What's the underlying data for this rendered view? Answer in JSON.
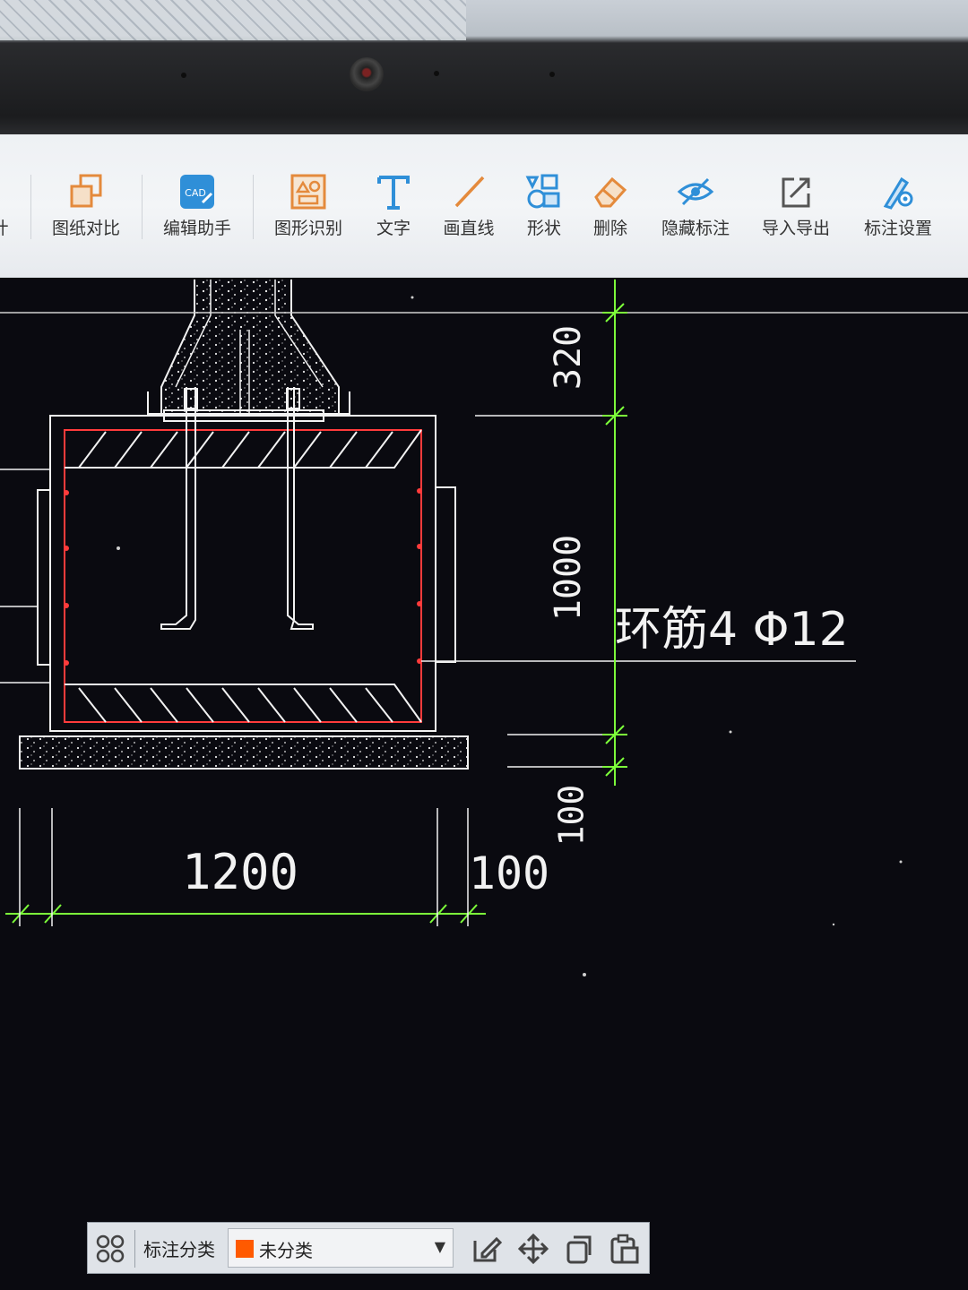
{
  "toolbar": {
    "partial_label": "计",
    "items": [
      {
        "label": "图纸对比",
        "icon": "compare-drawings-icon"
      },
      {
        "label": "编辑助手",
        "icon": "cad-edit-assistant-icon",
        "badge": "CAD"
      },
      {
        "label": "图形识别",
        "icon": "shape-recognition-icon"
      },
      {
        "label": "文字",
        "icon": "text-tool-icon"
      },
      {
        "label": "画直线",
        "icon": "draw-line-icon"
      },
      {
        "label": "形状",
        "icon": "shapes-icon"
      },
      {
        "label": "删除",
        "icon": "eraser-icon"
      },
      {
        "label": "隐藏标注",
        "icon": "hide-annotation-icon"
      },
      {
        "label": "导入导出",
        "icon": "import-export-icon"
      },
      {
        "label": "标注设置",
        "icon": "annotation-settings-icon"
      }
    ]
  },
  "drawing": {
    "dim_top": "320",
    "dim_middle": "1000",
    "dim_bottom_vertical": "100",
    "dim_width": "1200",
    "dim_side": "100",
    "annotation": "环筋4 Φ12"
  },
  "bottom_bar": {
    "label": "标注分类",
    "selected_value": "未分类",
    "swatch_color": "#ff5a00"
  },
  "colors": {
    "dimension_green": "#7dff3a",
    "outline_white": "#f2f2f2",
    "rebar_red": "#ff3b3b",
    "toolbar_blue": "#2f8fd8"
  }
}
